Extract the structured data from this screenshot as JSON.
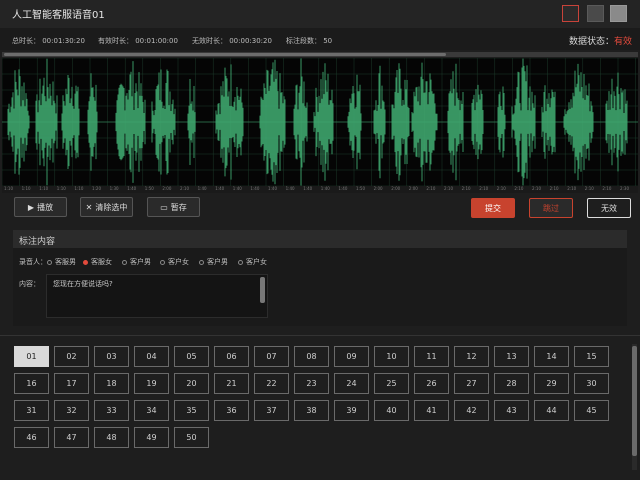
{
  "window": {
    "title": "人工智能客服语音01"
  },
  "info": {
    "total_duration": "总时长：  00:01:30:20",
    "valid_duration": "有效时长：  00:01:00:00",
    "invalid_duration": "无效时长：  00:00:30:20",
    "segment_count": "标注段数：  50",
    "status_label": "数据状态：",
    "status_value": "有效"
  },
  "ruler": {
    "ticks": [
      "1:10",
      "1:10",
      "1:10",
      "1:10",
      "1:10",
      "1:20",
      "1:30",
      "1:40",
      "1:50",
      "2:00",
      "2:10",
      "1:40",
      "1:40",
      "1:40",
      "1:40",
      "1:40",
      "1:40",
      "1:40",
      "1:40",
      "1:40",
      "1:50",
      "2:00",
      "2:00",
      "2:00",
      "2:10",
      "2:10",
      "2:10",
      "2:10",
      "2:10",
      "2:10",
      "2:10",
      "2:10",
      "2:10",
      "2:10",
      "2:10",
      "2:30"
    ]
  },
  "toolbar": {
    "play_label": "播放",
    "clear_label": "清除选中",
    "save_label": "暂存",
    "submit_label": "提交",
    "skip_label": "跳过",
    "invalid_label": "无效"
  },
  "annotation": {
    "title": "标注内容",
    "recorder_label": "录音人：",
    "options": [
      {
        "label": "客服男",
        "selected": false
      },
      {
        "label": "客服女",
        "selected": true
      },
      {
        "label": "客户男",
        "selected": false
      },
      {
        "label": "客户女",
        "selected": false
      },
      {
        "label": "客户男",
        "selected": false
      },
      {
        "label": "客户女",
        "selected": false
      }
    ],
    "content_label": "内容：",
    "content_text": "您现在方便说话吗?"
  },
  "segments": {
    "active": "01",
    "items": [
      "01",
      "02",
      "03",
      "04",
      "05",
      "06",
      "07",
      "08",
      "09",
      "10",
      "11",
      "12",
      "13",
      "14",
      "15",
      "16",
      "17",
      "18",
      "19",
      "20",
      "21",
      "22",
      "23",
      "24",
      "25",
      "26",
      "27",
      "28",
      "29",
      "30",
      "31",
      "32",
      "33",
      "34",
      "35",
      "36",
      "37",
      "38",
      "39",
      "40",
      "41",
      "42",
      "43",
      "44",
      "45",
      "46",
      "47",
      "48",
      "49",
      "50"
    ]
  },
  "colors": {
    "waveform": "#3fa66e",
    "accent": "#c8432e"
  }
}
